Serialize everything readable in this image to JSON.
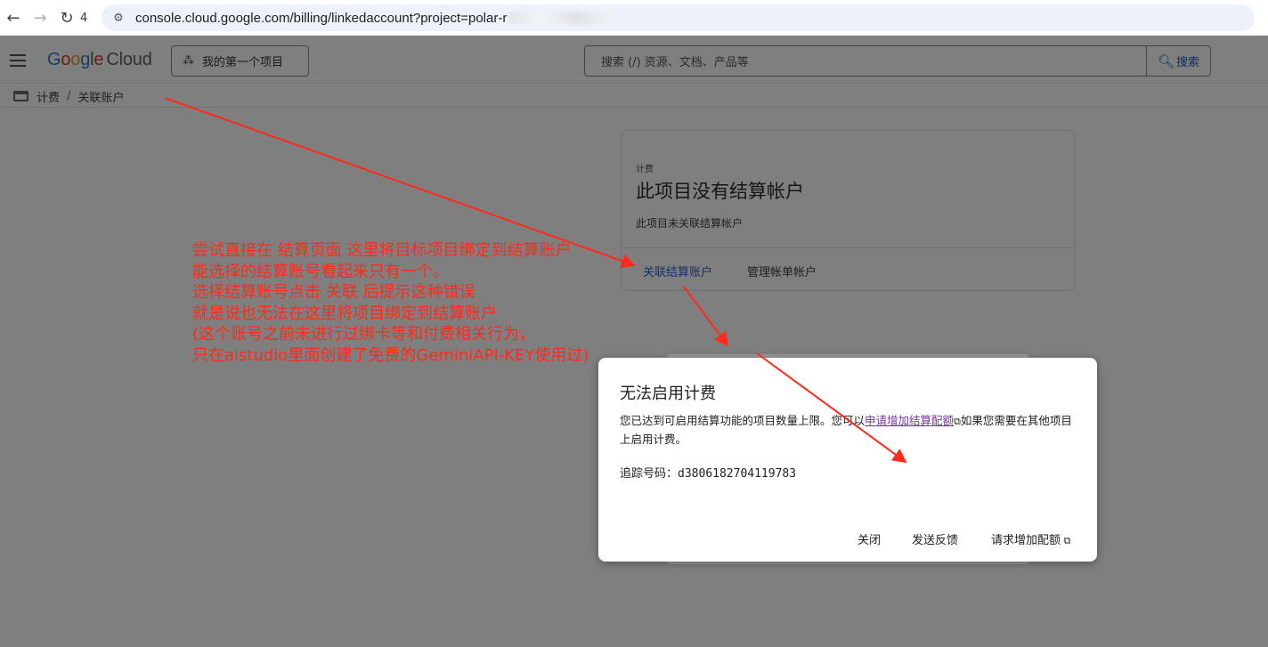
{
  "browser": {
    "back_icon": "arrow-left-icon",
    "forward_icon": "arrow-right-icon",
    "reload_icon": "reload-icon",
    "tab_count": "4",
    "url": "console.cloud.google.com/billing/linkedaccount?project=polar-r"
  },
  "header": {
    "menu_icon": "hamburger-icon",
    "logo_google": "Google",
    "logo_cloud": "Cloud",
    "project_picker_label": "我的第一个项目",
    "search_placeholder": "搜索 (/) 资源、文档、产品等",
    "search_button_label": "搜索"
  },
  "breadcrumb": {
    "items": [
      "计费",
      "关联账户"
    ]
  },
  "billing_card": {
    "overline": "计费",
    "title": "此项目没有结算帐户",
    "subtitle": "此项目未关联结算帐户",
    "link_primary": "关联结算账户",
    "link_secondary": "管理帐单帐户"
  },
  "dialog": {
    "title": "无法启用计费",
    "body_part1": "您已达到可启用结算功能的项目数量上限。您可以",
    "body_link": "申请增加结算配额",
    "body_part2": "如果您需要在其他项目上启用计费。",
    "tracking_label": "追踪号码：",
    "tracking_number": "d3806182704119783",
    "button_close": "关闭",
    "button_feedback": "发送反馈",
    "button_request": "请求增加配额"
  },
  "annotation": {
    "lines": [
      "尝试直接在 结算页面 这里将目标项目绑定到结算账户",
      "能选择的结算账号看起来只有一个。",
      "选择结算账号点击 关联 后提示这种错误",
      "就是说也无法在这里将项目绑定到结算账户",
      "(这个账号之前未进行过绑卡等和付费相关行为，",
      "只在aistudio里面创建了免费的GeminiAPI-KEY使用过)"
    ],
    "color": "#ff2a1a"
  }
}
